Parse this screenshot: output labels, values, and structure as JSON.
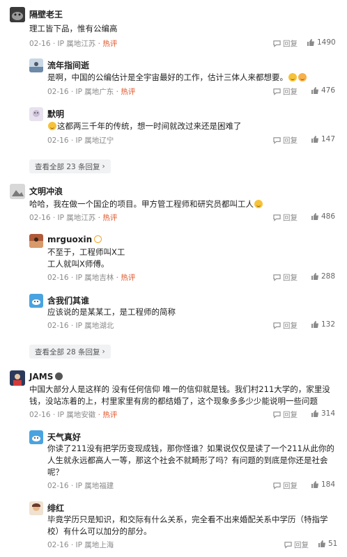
{
  "common": {
    "reply_label": "回复",
    "hot_label": "· 热评",
    "ip_prefix": "· IP 属地"
  },
  "comments": [
    {
      "user": "隔壁老王",
      "text": "理工皆下品，惟有公编高",
      "date": "02-16",
      "ip": "江苏",
      "likes": "1490"
    },
    {
      "user": "流年指间逝",
      "text": "是啊，中国的公编估计是全宇宙最好的工作，估计三体人来都想要。",
      "date": "02-16",
      "ip": "广东",
      "likes": "476"
    },
    {
      "user": "默明",
      "text": "这都两三千年的传统，想一时间就改过来还是困难了",
      "date": "02-16",
      "ip": "辽宁",
      "likes": "147"
    },
    {
      "more": "查看全部 23 条回复"
    },
    {
      "user": "文明冲浪",
      "text": "哈哈，我在做一个国企的项目。甲方管工程师和研究员都叫工人",
      "date": "02-16",
      "ip": "江苏",
      "likes": "486"
    },
    {
      "user": "mrguoxin",
      "text_lines": [
        "不至于，工程师叫X工",
        "工人就叫X师傅。"
      ],
      "date": "02-16",
      "ip": "吉林",
      "likes": "288"
    },
    {
      "user": "含我们其谁",
      "text": "应该说的是某某工，是工程师的简称",
      "date": "02-16",
      "ip": "湖北",
      "likes": "132"
    },
    {
      "more": "查看全部 28 条回复"
    },
    {
      "user": "JAMS",
      "text_lines": [
        "中国大部分人是这样的 没有任何信仰 唯一的信仰就是钱。我们村211大学的，家里没",
        "钱，没站冻着的上，村里家里有房的都结婚了，这个现象多多少少能说明一些问题"
      ],
      "date": "02-16",
      "ip": "安徽",
      "likes": "314"
    },
    {
      "user": "天气真好",
      "text_lines": [
        "你读了211没有把学历变现成钱，那你怪谁？如果说仅仅是读了一个211从此你的",
        "人生就永远都高人一等，那这个社会不就畸形了吗？有问题的到底是你还是社会",
        "呢？"
      ],
      "date": "02-16",
      "ip": "福建",
      "likes": "184"
    },
    {
      "user": "绯红",
      "text_lines": [
        "毕竟学历只是知识，和交际有什么关系，完全看不出来婚配关系中学历（特指学",
        "校）有什么可以加分的部分。"
      ],
      "date": "02-16",
      "ip": "上海",
      "likes": "51"
    }
  ],
  "colors": {
    "hot": "#e0552a",
    "meta": "#8a8a8a",
    "more_bg": "#f1f2f4"
  }
}
